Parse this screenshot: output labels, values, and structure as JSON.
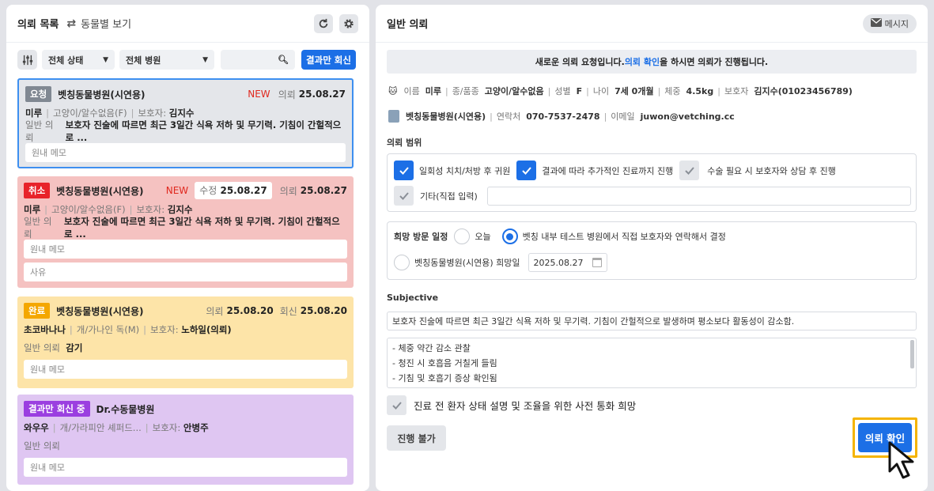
{
  "left": {
    "title": "의뢰 목록",
    "view_toggle": "동물별 보기",
    "filter_status": "전체 상태",
    "filter_hospital": "전체 병원",
    "result_only_button": "결과만 회신",
    "cards": [
      {
        "tag": "요청",
        "hospital": "벳칭동물병원(시연용)",
        "new": "NEW",
        "req_label": "의뢰",
        "req_date": "25.08.27",
        "pet": "미루",
        "breed": "고양이/알수없음(F)",
        "owner_label": "보호자:",
        "owner": "김지수",
        "type": "일반 의뢰",
        "summary": "보호자 진술에 따르면 최근 3일간 식욕 저하 및 무기력. 기침이 간헐적으로 ...",
        "memo": "원내 메모"
      },
      {
        "tag": "취소",
        "hospital": "벳칭동물병원(시연용)",
        "new": "NEW",
        "mod_label": "수정",
        "mod_date": "25.08.27",
        "req_label": "의뢰",
        "req_date": "25.08.27",
        "pet": "미루",
        "breed": "고양이/알수없음(F)",
        "owner_label": "보호자:",
        "owner": "김지수",
        "type": "일반 의뢰",
        "summary": "보호자 진술에 따르면 최근 3일간 식욕 저하 및 무기력. 기침이 간헐적으로 ...",
        "memo": "원내 메모",
        "reason": "사유"
      },
      {
        "tag": "완료",
        "hospital": "벳칭동물병원(시연용)",
        "req_label": "의뢰",
        "req_date": "25.08.20",
        "reply_label": "회신",
        "reply_date": "25.08.20",
        "pet": "초코바나나",
        "breed": "개/가나인 독(M)",
        "owner_label": "보호자:",
        "owner": "노하일(의뢰)",
        "type": "일반 의뢰",
        "summary": "감기",
        "memo": "원내 메모"
      },
      {
        "tag": "결과만 회신 중",
        "hospital": "Dr.수동물병원",
        "pet": "와우우",
        "breed": "개/가라피안 셰퍼드...",
        "owner_label": "보호자:",
        "owner": "안병주",
        "type": "일반 의뢰",
        "memo": "원내 메모"
      }
    ]
  },
  "right": {
    "title": "일반 의뢰",
    "message_button": "메시지",
    "notice_pre": "새로운 의뢰 요청입니다. ",
    "notice_link": "의뢰 확인",
    "notice_post": "을 하시면 의뢰가 진행됩니다.",
    "pet_info": {
      "name_label": "이름",
      "name": "미루",
      "breed_label": "종/품종",
      "breed": "고양이/알수없음",
      "sex_label": "성별",
      "sex": "F",
      "age_label": "나이",
      "age": "7세 0개월",
      "weight_label": "체중",
      "weight": "4.5kg",
      "owner_label": "보호자",
      "owner": "김지수(01023456789)"
    },
    "hospital_info": {
      "name": "벳칭동물병원(시연용)",
      "phone_label": "연락처",
      "phone": "070-7537-2478",
      "email_label": "이메일",
      "email": "juwon@vetching.cc"
    },
    "scope_title": "의뢰 범위",
    "scope": [
      {
        "label": "일회성 치치/처방 후 귀원",
        "checked": true
      },
      {
        "label": "결과에 따라 추가적인 진료까지 진행",
        "checked": true
      },
      {
        "label": "수술 필요 시 보호자와 상담 후 진행",
        "checked": false
      },
      {
        "label": "기타(직접 입력)",
        "checked": false
      }
    ],
    "visit_title": "희망 방문 일정",
    "visit_today": "오늘",
    "visit_internal": "벳칭 내부 테스트 병원에서 직접 보호자와 연락해서 결정",
    "visit_hospital": "벳칭동물병원(시연용) 희망일",
    "visit_date": "2025.08.27",
    "subjective_title": "Subjective",
    "subjective": "보호자 진술에 따르면 최근 3일간 식욕 저하 및 무기력. 기침이 간헐적으로 발생하며 평소보다 활동성이 감소함.",
    "notes": [
      "- 체중 약간 감소 관찰",
      "- 청진 시 호흡음 거칠게 들림",
      "- 기침 및 호흡기 증상 확인됨"
    ],
    "call_label": "진료 전 환자 상태 설명 및 조율을 위한 사전 통화 희망",
    "reject_button": "진행 불가",
    "confirm_button": "의뢰 확인"
  }
}
